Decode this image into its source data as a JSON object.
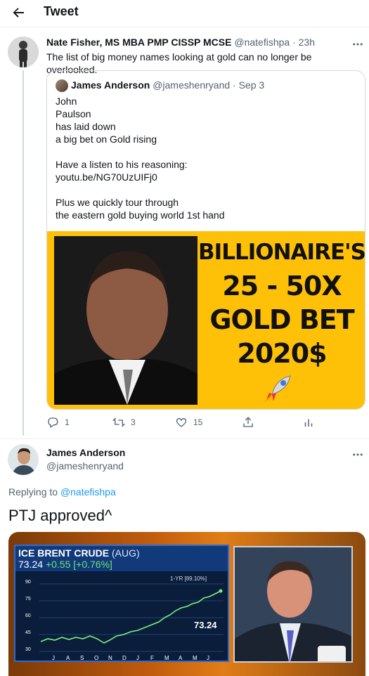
{
  "header": {
    "title": "Tweet"
  },
  "tweet1": {
    "name": "Nate Fisher, MS MBA PMP CISSP MCSE",
    "handle": "@natefishpa",
    "time": "· 23h",
    "text": "The list of big money names looking at gold can no longer be overlooked.",
    "quote": {
      "name": "James Anderson",
      "handle": "@jameshenryand",
      "time": "· Sep 3",
      "lines": [
        "John",
        "Paulson",
        "has laid down",
        "a big bet on Gold rising"
      ],
      "lines2": [
        "Have a listen to his reasoning:",
        "youtu.be/NG70UzUIFj0"
      ],
      "lines3": [
        "Plus we quickly tour through",
        "the eastern gold buying world 1st hand"
      ],
      "image_text": [
        "BILLIONAIRE'S",
        "25 - 50X",
        "GOLD BET",
        "2020$"
      ]
    },
    "actions": {
      "replies": "1",
      "retweets": "3",
      "likes": "15"
    }
  },
  "tweet2": {
    "name": "James Anderson",
    "handle": "@jameshenryand",
    "replying_label": "Replying to",
    "replying_to": "@natefishpa",
    "text": "PTJ approved^",
    "media": {
      "ticker_name": "ICE BRENT CRUDE",
      "ticker_sub": "(AUG)",
      "price": "73.24",
      "change": "+0.55",
      "change_pct": "[+0.76%]",
      "range_label": "1-YR",
      "range_pct": "[89.10%]",
      "last_value": "73.24",
      "y_ticks": [
        "90",
        "75",
        "60",
        "45",
        "30"
      ],
      "x_ticks": [
        "J",
        "A",
        "S",
        "O",
        "N",
        "D",
        "J",
        "F",
        "M",
        "A",
        "M",
        "J"
      ]
    }
  },
  "colors": {
    "accent": "#1d9bf0",
    "muted": "#536471",
    "gold": "#ffc107"
  }
}
